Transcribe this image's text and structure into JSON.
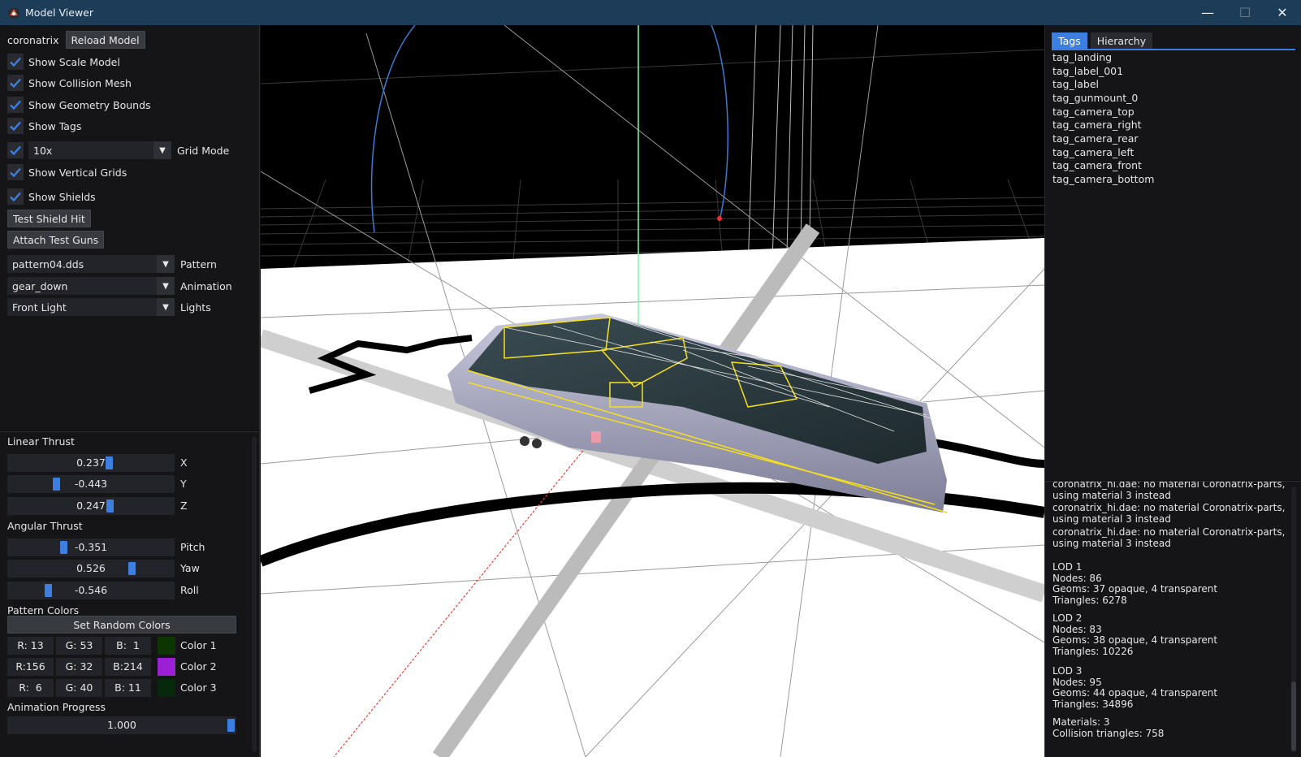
{
  "window": {
    "title": "Model Viewer",
    "minimize": "—",
    "maximize": "☐",
    "close": "✕"
  },
  "controls": {
    "model_name": "coronatrix",
    "reload_button": "Reload Model",
    "checkboxes": [
      {
        "label": "Show Scale Model",
        "checked": true
      },
      {
        "label": "Show Collision Mesh",
        "checked": true
      },
      {
        "label": "Show Geometry Bounds",
        "checked": true
      },
      {
        "label": "Show Tags",
        "checked": true
      }
    ],
    "grid_mode": {
      "checked": true,
      "value": "10x",
      "label": "Grid Mode"
    },
    "show_vertical_grids": "Show Vertical Grids",
    "show_shields": "Show Shields",
    "test_shield_hit": "Test Shield Hit",
    "attach_test_guns": "Attach Test Guns",
    "pattern": {
      "value": "pattern04.dds",
      "label": "Pattern"
    },
    "animation": {
      "value": "gear_down",
      "label": "Animation"
    },
    "lights": {
      "value": "Front Light",
      "label": "Lights"
    }
  },
  "thrust": {
    "linear_title": "Linear Thrust",
    "linear": [
      {
        "label": "X",
        "value": "0.237",
        "fraction": 0.6185
      },
      {
        "label": "Y",
        "value": "-0.443",
        "fraction": 0.2785
      },
      {
        "label": "Z",
        "value": "0.247",
        "fraction": 0.6235
      }
    ],
    "angular_title": "Angular Thrust",
    "angular": [
      {
        "label": "Pitch",
        "value": "-0.351",
        "fraction": 0.3245
      },
      {
        "label": "Yaw",
        "value": "0.526",
        "fraction": 0.763
      },
      {
        "label": "Roll",
        "value": "-0.546",
        "fraction": 0.227
      }
    ]
  },
  "pattern_colors": {
    "title": "Pattern Colors",
    "random_button": "Set Random Colors",
    "colors": [
      {
        "r": "R: 13",
        "g": "G: 53",
        "b": "B:  1",
        "label": "Color 1",
        "hex": "#0d3501"
      },
      {
        "r": "R:156",
        "g": "G: 32",
        "b": "B:214",
        "label": "Color 2",
        "hex": "#9c20d6"
      },
      {
        "r": "R:  6",
        "g": "G: 40",
        "b": "B: 11",
        "label": "Color 3",
        "hex": "#06280b"
      }
    ]
  },
  "animation_progress": {
    "title": "Animation Progress",
    "value": "1.000",
    "fraction": 1.0
  },
  "right_panel": {
    "tabs": [
      "Tags",
      "Hierarchy"
    ],
    "active_tab": "Tags",
    "tags": [
      "tag_landing",
      "tag_label_001",
      "tag_label",
      "tag_gunmount_0",
      "tag_camera_top",
      "tag_camera_right",
      "tag_camera_rear",
      "tag_camera_left",
      "tag_camera_front",
      "tag_camera_bottom"
    ]
  },
  "log": {
    "messages": [
      "coronatrix_hi.dae: no material Coronatrix-parts,\nusing material 3 instead",
      "coronatrix_hi.dae: no material Coronatrix-parts,\nusing material 3 instead",
      "coronatrix_hi.dae: no material Coronatrix-parts,\nusing material 3 instead"
    ],
    "stats": [
      "LOD 1\nNodes: 86\nGeoms: 37 opaque, 4 transparent\nTriangles: 6278",
      "LOD 2\nNodes: 83\nGeoms: 38 opaque, 4 transparent\nTriangles: 10226",
      "LOD 3\nNodes: 95\nGeoms: 44 opaque, 4 transparent\nTriangles: 34896",
      "Materials: 3\nCollision triangles: 758"
    ]
  },
  "theme": {
    "accent": "#3d7fe0",
    "titlebar": "#1d3c58",
    "panel": "#151518"
  }
}
